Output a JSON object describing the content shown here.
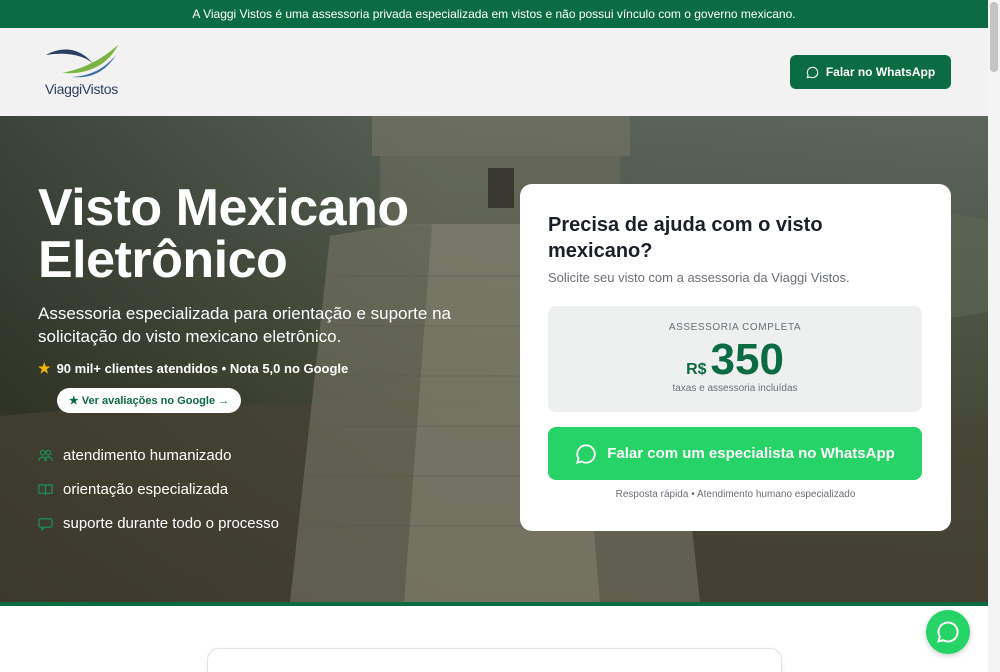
{
  "notice_bar": {
    "text": "A Viaggi Vistos é uma assessoria privada especializada em vistos e não possui vínculo com o governo mexicano."
  },
  "header": {
    "logo_text": "ViaggiVistos",
    "whatsapp_button": "Falar no WhatsApp",
    "whatsapp_icon": "whatsapp-icon"
  },
  "hero": {
    "title": "Visto Mexicano Eletrônico",
    "subtitle": "Assessoria especializada para orientação e suporte na solicitação do visto mexicano eletrônico.",
    "rating_text": "90 mil+ clientes atendidos • Nota 5,0 no Google",
    "reviews_button": "★ Ver avaliações no Google →",
    "features": [
      {
        "icon": "people-icon",
        "label": "atendimento humanizado"
      },
      {
        "icon": "book-icon",
        "label": "orientação especializada"
      },
      {
        "icon": "chat-icon",
        "label": "suporte durante todo o processo"
      }
    ]
  },
  "card": {
    "title": "Precisa de ajuda com o visto mexicano?",
    "subtitle": "Solicite seu visto com a assessoria da Viaggi Vistos.",
    "price_label": "ASSESSORIA COMPLETA",
    "currency": "R$",
    "amount": "350",
    "price_note": "taxas e assessoria incluídas",
    "cta": "Falar com um especialista no WhatsApp",
    "footnote": "Resposta rápida • Atendimento humano especializado"
  },
  "colors": {
    "brand_green": "#0b6b43",
    "whatsapp_green": "#25d366",
    "star": "#f5b800"
  }
}
